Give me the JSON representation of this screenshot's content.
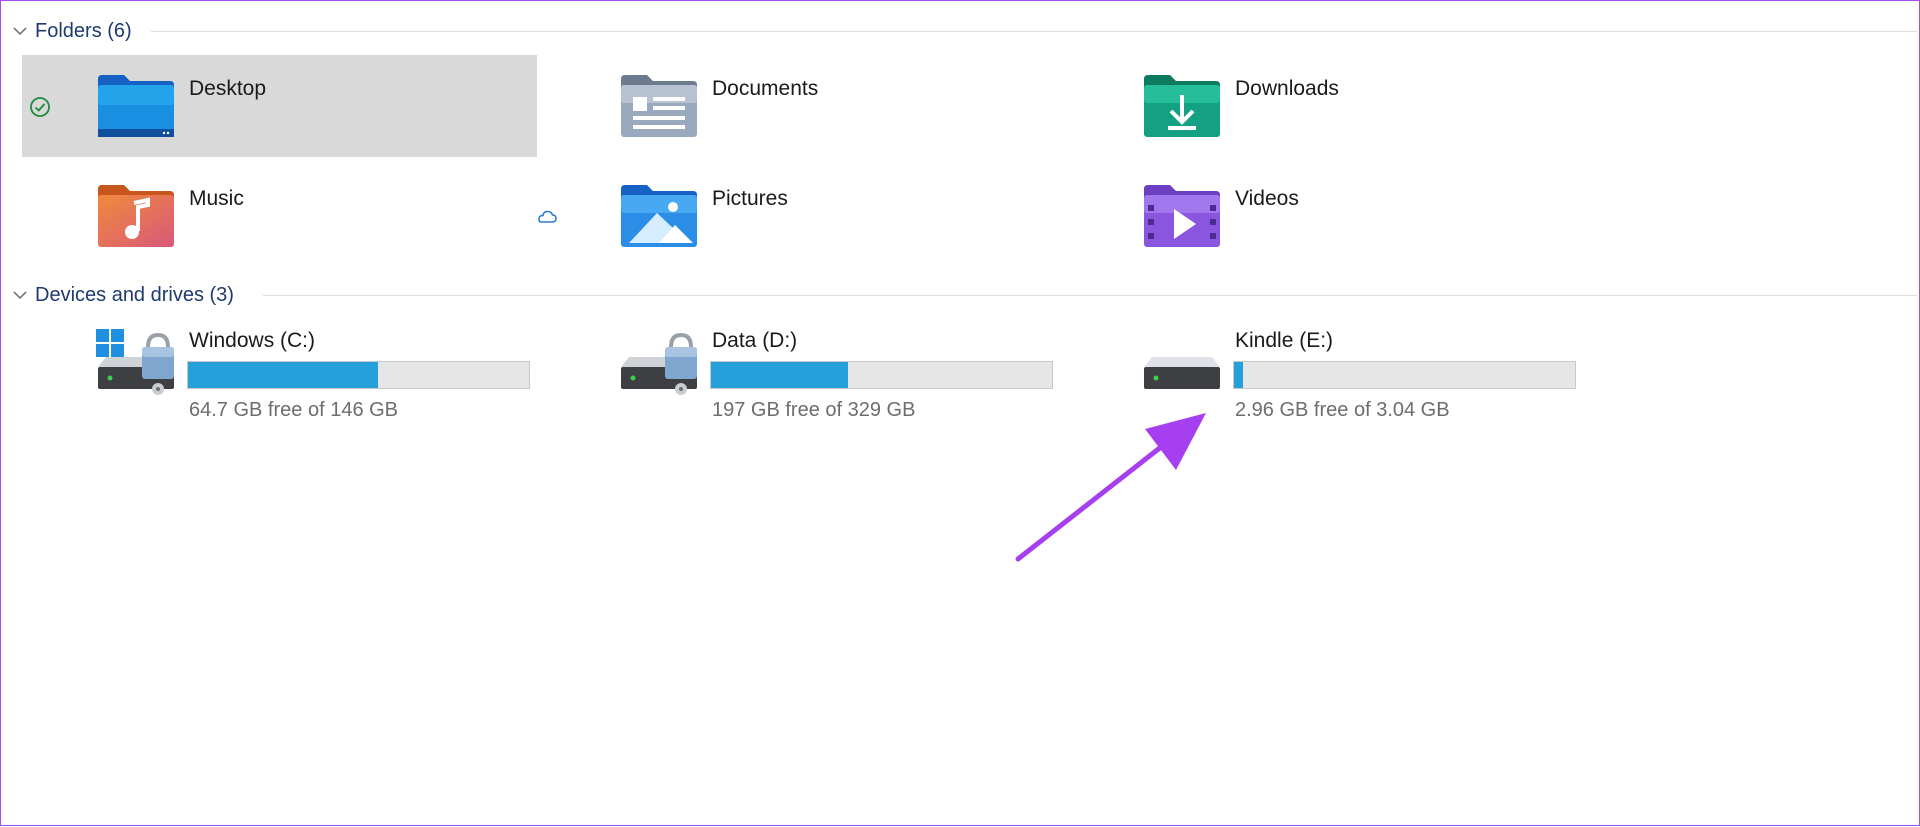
{
  "folders_section": {
    "title": "Folders (6)",
    "items": [
      {
        "name": "Desktop",
        "icon": "desktop-folder-icon",
        "selected": true,
        "status": "synced-check-icon"
      },
      {
        "name": "Documents",
        "icon": "documents-folder-icon",
        "selected": false,
        "status": ""
      },
      {
        "name": "Downloads",
        "icon": "downloads-folder-icon",
        "selected": false,
        "status": ""
      },
      {
        "name": "Music",
        "icon": "music-folder-icon",
        "selected": false,
        "status": ""
      },
      {
        "name": "Pictures",
        "icon": "pictures-folder-icon",
        "selected": false,
        "status": "cloud-icon"
      },
      {
        "name": "Videos",
        "icon": "videos-folder-icon",
        "selected": false,
        "status": ""
      }
    ]
  },
  "drives_section": {
    "title": "Devices and drives (3)",
    "items": [
      {
        "name": "Windows (C:)",
        "free_text": "64.7 GB free of 146 GB",
        "used_fraction": 0.557,
        "icon": "windows-drive-icon"
      },
      {
        "name": "Data (D:)",
        "free_text": "197 GB free of 329 GB",
        "used_fraction": 0.401,
        "icon": "locked-drive-icon"
      },
      {
        "name": "Kindle (E:)",
        "free_text": "2.96 GB free of 3.04 GB",
        "used_fraction": 0.026,
        "icon": "removable-drive-icon"
      }
    ]
  },
  "colors": {
    "accent": "#26a0da",
    "selection": "#d9d9d9",
    "section_text": "#1e3a6e",
    "annotation_arrow": "#a63ff0"
  }
}
